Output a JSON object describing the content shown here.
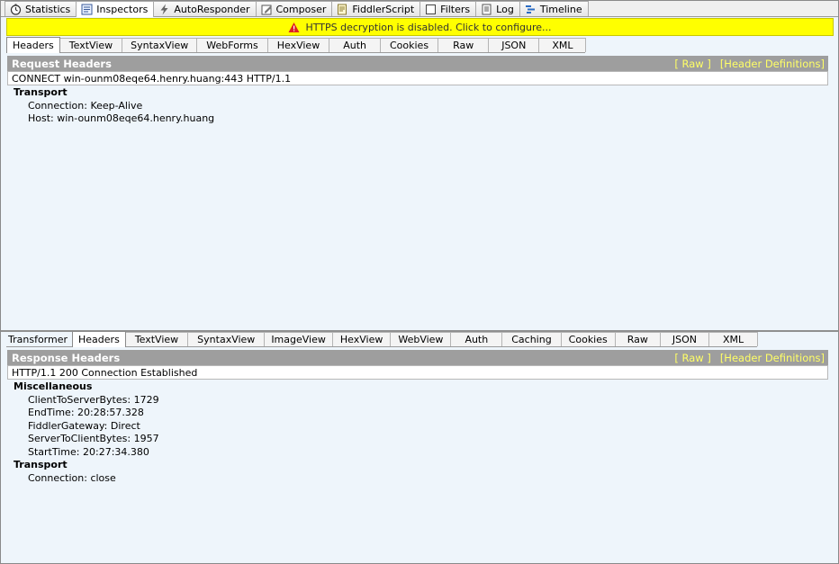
{
  "top_tabs": [
    {
      "label": "Statistics",
      "icon": "stopwatch-icon"
    },
    {
      "label": "Inspectors",
      "icon": "inspect-icon",
      "active": true
    },
    {
      "label": "AutoResponder",
      "icon": "lightning-icon"
    },
    {
      "label": "Composer",
      "icon": "pencil-icon"
    },
    {
      "label": "FiddlerScript",
      "icon": "script-icon"
    },
    {
      "label": "Filters",
      "icon": "checkbox-icon"
    },
    {
      "label": "Log",
      "icon": "log-icon"
    },
    {
      "label": "Timeline",
      "icon": "timeline-icon"
    }
  ],
  "warning": {
    "text": "HTTPS decryption is disabled. Click to configure...",
    "icon": "warning-icon",
    "color": "#ffff00"
  },
  "request": {
    "tabs": [
      "Headers",
      "TextView",
      "SyntaxView",
      "WebForms",
      "HexView",
      "Auth",
      "Cookies",
      "Raw",
      "JSON",
      "XML"
    ],
    "active_tab": "Headers",
    "title": "Request Headers",
    "raw_link": "[ Raw ]",
    "defs_link": "[Header Definitions]",
    "status_line": "CONNECT win-ounm08eqe64.henry.huang:443 HTTP/1.1",
    "groups": [
      {
        "name": "Transport",
        "items": [
          "Connection: Keep-Alive",
          "Host: win-ounm08eqe64.henry.huang"
        ]
      }
    ]
  },
  "response": {
    "tabs": [
      "Transformer",
      "Headers",
      "TextView",
      "SyntaxView",
      "ImageView",
      "HexView",
      "WebView",
      "Auth",
      "Caching",
      "Cookies",
      "Raw",
      "JSON",
      "XML"
    ],
    "active_tab": "Headers",
    "title": "Response Headers",
    "raw_link": "[ Raw ]",
    "defs_link": "[Header Definitions]",
    "status_line": "HTTP/1.1 200 Connection Established",
    "groups": [
      {
        "name": "Miscellaneous",
        "items": [
          "ClientToServerBytes: 1729",
          "EndTime: 20:28:57.328",
          "FiddlerGateway: Direct",
          "ServerToClientBytes: 1957",
          "StartTime: 20:27:34.380"
        ]
      },
      {
        "name": "Transport",
        "items": [
          "Connection: close"
        ]
      }
    ]
  },
  "colors": {
    "panel_bg": "#eef5fb",
    "header_bar": "#9e9e9e",
    "link": "#ffff66"
  }
}
